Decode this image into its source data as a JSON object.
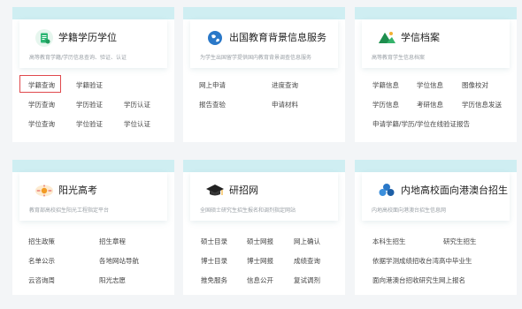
{
  "cards": [
    {
      "title": "学籍学历学位",
      "desc": "高等教育学籍/学历信息查询、验证、认证",
      "icon": "document-icon",
      "rows": [
        [
          "学籍查询",
          "学籍验证"
        ],
        [
          "学历查询",
          "学历验证",
          "学历认证"
        ],
        [
          "学位查询",
          "学位验证",
          "学位认证"
        ]
      ]
    },
    {
      "title": "出国教育背景信息服务",
      "desc": "为学生出国留学提供国内教育背景调查信息服务",
      "icon": "globe-icon",
      "rows": [
        [
          "网上申请",
          "进度查询"
        ],
        [
          "报告查验",
          "申请材料"
        ]
      ]
    },
    {
      "title": "学信档案",
      "desc": "高等教育学生信息档案",
      "icon": "folder-icon",
      "rows": [
        [
          "学籍信息",
          "学位信息",
          "图像校对"
        ],
        [
          "学历信息",
          "考研信息",
          "学历信息发送"
        ],
        [
          "申请学籍/学历/学位在线验证报告"
        ]
      ]
    },
    {
      "title": "阳光高考",
      "desc": "教育部高校招生阳光工程指定平台",
      "icon": "sun-logo-icon",
      "rows": [
        [
          "招生政策",
          "招生章程"
        ],
        [
          "名单公示",
          "各地网站导航"
        ],
        [
          "云咨询周",
          "阳光志愿"
        ]
      ]
    },
    {
      "title": "研招网",
      "desc": "全国硕士研究生招生报名和调剂指定网站",
      "icon": "graduation-cap-icon",
      "rows": [
        [
          "硕士目录",
          "硕士网报",
          "网上确认"
        ],
        [
          "博士目录",
          "博士网报",
          "成绩查询"
        ],
        [
          "推免服务",
          "信息公开",
          "复试调剂"
        ]
      ]
    },
    {
      "title": "内地高校面向港澳台招生",
      "desc": "内地高校面向港澳台招生信息网",
      "icon": "people-icon",
      "rows": [
        [
          "本科生招生",
          "研究生招生"
        ],
        [
          "依据学测成绩招收台湾高中毕业生"
        ],
        [
          "面向港澳台招收研究生网上报名"
        ]
      ]
    }
  ],
  "colors": {
    "accent_bar": "#cfeef2",
    "highlight": "#e0494d"
  }
}
